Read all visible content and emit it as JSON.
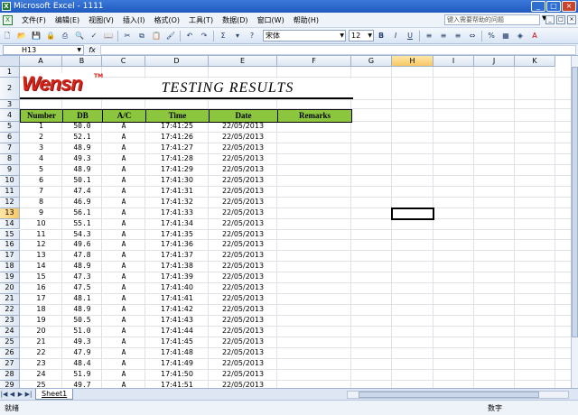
{
  "window": {
    "title": "Microsoft Excel - 1111"
  },
  "menu": {
    "items": [
      "文件(F)",
      "编辑(E)",
      "视图(V)",
      "插入(I)",
      "格式(O)",
      "工具(T)",
      "数据(D)",
      "窗口(W)",
      "帮助(H)"
    ],
    "help_placeholder": "键入需要帮助的问题"
  },
  "toolbar": {
    "font_name": "宋体",
    "font_size": "12",
    "sigma": "Σ"
  },
  "formula_bar": {
    "name_box": "H13",
    "fx": "fx"
  },
  "columns": [
    "A",
    "B",
    "C",
    "D",
    "E",
    "F",
    "G",
    "H",
    "I",
    "J",
    "K"
  ],
  "active_cell": {
    "col": "H",
    "row": 13
  },
  "sheet": {
    "logo_text": "Wensn",
    "logo_tm": "TM",
    "title": "TESTING RESULTS",
    "headers": [
      "Number",
      "DB",
      "A/C",
      "Time",
      "Date",
      "Remarks"
    ],
    "rows": [
      [
        "1",
        "50.0",
        "A",
        "17:41:25",
        "22/05/2013"
      ],
      [
        "2",
        "52.1",
        "A",
        "17:41:26",
        "22/05/2013"
      ],
      [
        "3",
        "48.9",
        "A",
        "17:41:27",
        "22/05/2013"
      ],
      [
        "4",
        "49.3",
        "A",
        "17:41:28",
        "22/05/2013"
      ],
      [
        "5",
        "48.9",
        "A",
        "17:41:29",
        "22/05/2013"
      ],
      [
        "6",
        "50.1",
        "A",
        "17:41:30",
        "22/05/2013"
      ],
      [
        "7",
        "47.4",
        "A",
        "17:41:31",
        "22/05/2013"
      ],
      [
        "8",
        "46.9",
        "A",
        "17:41:32",
        "22/05/2013"
      ],
      [
        "9",
        "56.1",
        "A",
        "17:41:33",
        "22/05/2013"
      ],
      [
        "10",
        "55.1",
        "A",
        "17:41:34",
        "22/05/2013"
      ],
      [
        "11",
        "54.3",
        "A",
        "17:41:35",
        "22/05/2013"
      ],
      [
        "12",
        "49.6",
        "A",
        "17:41:36",
        "22/05/2013"
      ],
      [
        "13",
        "47.8",
        "A",
        "17:41:37",
        "22/05/2013"
      ],
      [
        "14",
        "48.9",
        "A",
        "17:41:38",
        "22/05/2013"
      ],
      [
        "15",
        "47.3",
        "A",
        "17:41:39",
        "22/05/2013"
      ],
      [
        "16",
        "47.5",
        "A",
        "17:41:40",
        "22/05/2013"
      ],
      [
        "17",
        "48.1",
        "A",
        "17:41:41",
        "22/05/2013"
      ],
      [
        "18",
        "48.9",
        "A",
        "17:41:42",
        "22/05/2013"
      ],
      [
        "19",
        "50.5",
        "A",
        "17:41:43",
        "22/05/2013"
      ],
      [
        "20",
        "51.0",
        "A",
        "17:41:44",
        "22/05/2013"
      ],
      [
        "21",
        "49.3",
        "A",
        "17:41:45",
        "22/05/2013"
      ],
      [
        "22",
        "47.9",
        "A",
        "17:41:48",
        "22/05/2013"
      ],
      [
        "23",
        "48.4",
        "A",
        "17:41:49",
        "22/05/2013"
      ],
      [
        "24",
        "51.9",
        "A",
        "17:41:50",
        "22/05/2013"
      ],
      [
        "25",
        "49.7",
        "A",
        "17:41:51",
        "22/05/2013"
      ]
    ]
  },
  "sheet_tabs": [
    "Sheet1"
  ],
  "status": {
    "left": "就绪",
    "mode": "数字"
  },
  "colors": {
    "header_green": "#8cc63f",
    "logo_red": "#d42318"
  }
}
